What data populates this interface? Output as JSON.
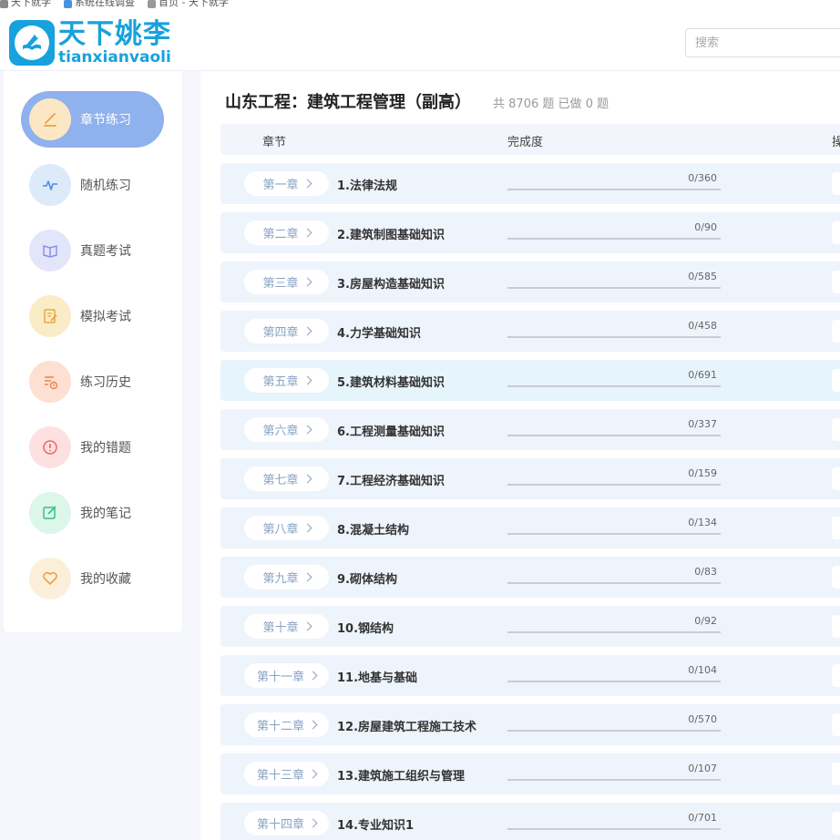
{
  "bookmarks": [
    {
      "label": "天下就学",
      "color": "#888"
    },
    {
      "label": "系统在线调查",
      "color": "#4a90e2"
    },
    {
      "label": "首页 - 天下就学",
      "color": "#999"
    }
  ],
  "header": {
    "logo_cn": "天下姚李",
    "logo_en": "tianxianvaoli",
    "search_placeholder": "搜索"
  },
  "sidebar": {
    "items": [
      {
        "label": "章节练习",
        "icon": "pencil-icon",
        "icon_bg": "#fbe7c4",
        "icon_color": "#e8a243",
        "active": true
      },
      {
        "label": "随机练习",
        "icon": "pulse-icon",
        "icon_bg": "#dceafa",
        "icon_color": "#4a8ee0",
        "active": false
      },
      {
        "label": "真题考试",
        "icon": "book-icon",
        "icon_bg": "#e3e6fb",
        "icon_color": "#8891e6",
        "active": false
      },
      {
        "label": "模拟考试",
        "icon": "edit-doc-icon",
        "icon_bg": "#fbecc8",
        "icon_color": "#e8a73d",
        "active": false
      },
      {
        "label": "练习历史",
        "icon": "history-list-icon",
        "icon_bg": "#fde0d2",
        "icon_color": "#ef8150",
        "active": false
      },
      {
        "label": "我的错题",
        "icon": "alert-circle-icon",
        "icon_bg": "#fde1e1",
        "icon_color": "#ef6666",
        "active": false
      },
      {
        "label": "我的笔记",
        "icon": "note-edit-icon",
        "icon_bg": "#dcf6ea",
        "icon_color": "#39c07f",
        "active": false
      },
      {
        "label": "我的收藏",
        "icon": "heart-icon",
        "icon_bg": "#fcefd9",
        "icon_color": "#eea04a",
        "active": false
      }
    ]
  },
  "main": {
    "title": "山东工程：建筑工程管理（副高）",
    "total_prefix": "共",
    "total": "8706",
    "total_unit": "题",
    "done_prefix": "已做",
    "done": "0",
    "done_unit": "题",
    "columns": {
      "chapter": "章节",
      "progress": "完成度",
      "action": "操"
    },
    "rows": [
      {
        "chip": "第一章",
        "title": "1.法律法规",
        "done": 0,
        "total": 360,
        "progress_text": "0/360"
      },
      {
        "chip": "第二章",
        "title": "2.建筑制图基础知识",
        "done": 0,
        "total": 90,
        "progress_text": "0/90"
      },
      {
        "chip": "第三章",
        "title": "3.房屋构造基础知识",
        "done": 0,
        "total": 585,
        "progress_text": "0/585"
      },
      {
        "chip": "第四章",
        "title": "4.力学基础知识",
        "done": 0,
        "total": 458,
        "progress_text": "0/458"
      },
      {
        "chip": "第五章",
        "title": "5.建筑材料基础知识",
        "done": 0,
        "total": 691,
        "progress_text": "0/691"
      },
      {
        "chip": "第六章",
        "title": "6.工程测量基础知识",
        "done": 0,
        "total": 337,
        "progress_text": "0/337"
      },
      {
        "chip": "第七章",
        "title": "7.工程经济基础知识",
        "done": 0,
        "total": 159,
        "progress_text": "0/159"
      },
      {
        "chip": "第八章",
        "title": "8.混凝土结构",
        "done": 0,
        "total": 134,
        "progress_text": "0/134"
      },
      {
        "chip": "第九章",
        "title": "9.砌体结构",
        "done": 0,
        "total": 83,
        "progress_text": "0/83"
      },
      {
        "chip": "第十章",
        "title": "10.钢结构",
        "done": 0,
        "total": 92,
        "progress_text": "0/92"
      },
      {
        "chip": "第十一章",
        "title": "11.地基与基础",
        "done": 0,
        "total": 104,
        "progress_text": "0/104"
      },
      {
        "chip": "第十二章",
        "title": "12.房屋建筑工程施工技术",
        "done": 0,
        "total": 570,
        "progress_text": "0/570"
      },
      {
        "chip": "第十三章",
        "title": "13.建筑施工组织与管理",
        "done": 0,
        "total": 107,
        "progress_text": "0/107"
      },
      {
        "chip": "第十四章",
        "title": "14.专业知识1",
        "done": 0,
        "total": 701,
        "progress_text": "0/701"
      }
    ]
  }
}
